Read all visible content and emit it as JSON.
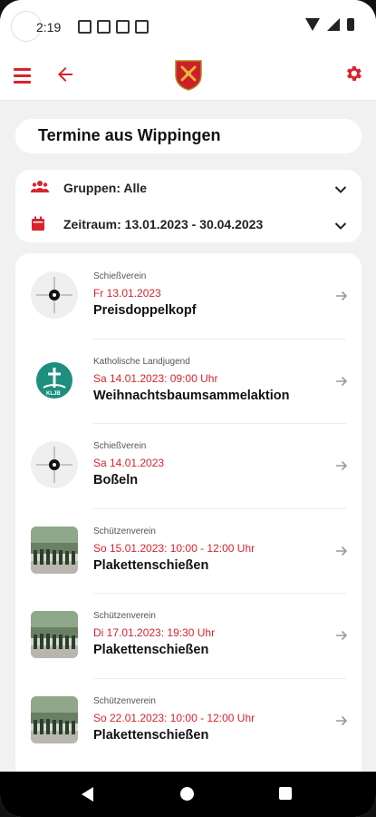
{
  "status_bar": {
    "time": "2:19"
  },
  "header": {
    "title": "Termine aus Wippingen"
  },
  "filters": {
    "groups_label": "Gruppen: Alle",
    "period_label": "Zeitraum: 13.01.2023 - 30.04.2023"
  },
  "events": [
    {
      "group": "Schießverein",
      "date": "Fr 13.01.2023",
      "title": "Preisdoppelkopf",
      "thumb": "target-logo"
    },
    {
      "group": "Katholische Landjugend",
      "date": "Sa 14.01.2023: 09:00 Uhr",
      "title": "Weihnachtsbaumsammelaktion",
      "thumb": "kljb-logo"
    },
    {
      "group": "Schießverein",
      "date": "Sa 14.01.2023",
      "title": "Boßeln",
      "thumb": "target-logo"
    },
    {
      "group": "Schützenverein",
      "date": "So 15.01.2023: 10:00 - 12:00 Uhr",
      "title": "Plakettenschießen",
      "thumb": "marching-photo"
    },
    {
      "group": "Schützenverein",
      "date": "Di 17.01.2023: 19:30 Uhr",
      "title": "Plakettenschießen",
      "thumb": "marching-photo"
    },
    {
      "group": "Schützenverein",
      "date": "So 22.01.2023: 10:00 - 12:00 Uhr",
      "title": "Plakettenschießen",
      "thumb": "marching-photo"
    }
  ],
  "colors": {
    "accent": "#d9232d",
    "background": "#f1f1f1",
    "card": "#ffffff"
  },
  "icons": {
    "appbar": [
      "menu-icon",
      "back-arrow-icon",
      "crest-logo",
      "gear-icon"
    ],
    "filters": [
      "group-icon",
      "calendar-icon",
      "chevron-down-icon"
    ],
    "list": [
      "arrow-right-icon"
    ]
  }
}
